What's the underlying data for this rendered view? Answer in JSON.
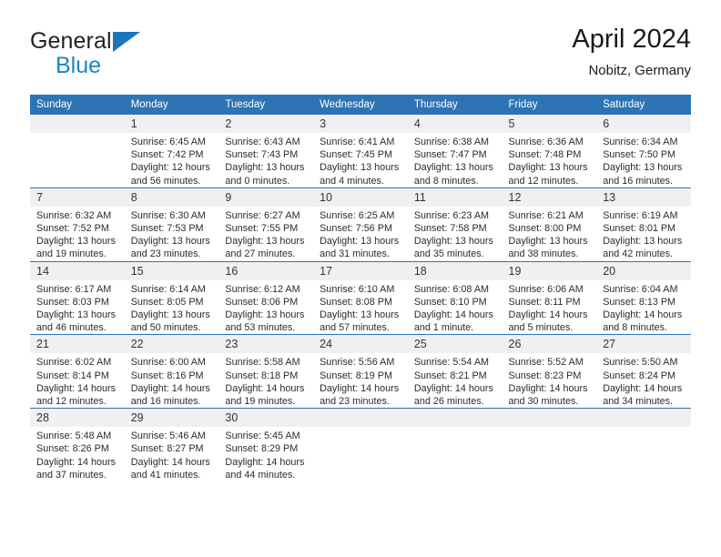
{
  "brand": {
    "name_top": "General",
    "name_bottom": "Blue",
    "triangle_color": "#1b75bb",
    "text_color_top": "#231f20",
    "text_color_bottom": "#1b84c9"
  },
  "header": {
    "title": "April 2024",
    "subtitle": "Nobitz, Germany",
    "accent_color": "#2e74b5",
    "daynum_band_color": "#f0f0f0"
  },
  "weekday_headers": [
    "Sunday",
    "Monday",
    "Tuesday",
    "Wednesday",
    "Thursday",
    "Friday",
    "Saturday"
  ],
  "weeks": [
    [
      {
        "day": "",
        "sunrise": "",
        "sunset": "",
        "daylight_1": "",
        "daylight_2": ""
      },
      {
        "day": "1",
        "sunrise": "Sunrise: 6:45 AM",
        "sunset": "Sunset: 7:42 PM",
        "daylight_1": "Daylight: 12 hours",
        "daylight_2": "and 56 minutes."
      },
      {
        "day": "2",
        "sunrise": "Sunrise: 6:43 AM",
        "sunset": "Sunset: 7:43 PM",
        "daylight_1": "Daylight: 13 hours",
        "daylight_2": "and 0 minutes."
      },
      {
        "day": "3",
        "sunrise": "Sunrise: 6:41 AM",
        "sunset": "Sunset: 7:45 PM",
        "daylight_1": "Daylight: 13 hours",
        "daylight_2": "and 4 minutes."
      },
      {
        "day": "4",
        "sunrise": "Sunrise: 6:38 AM",
        "sunset": "Sunset: 7:47 PM",
        "daylight_1": "Daylight: 13 hours",
        "daylight_2": "and 8 minutes."
      },
      {
        "day": "5",
        "sunrise": "Sunrise: 6:36 AM",
        "sunset": "Sunset: 7:48 PM",
        "daylight_1": "Daylight: 13 hours",
        "daylight_2": "and 12 minutes."
      },
      {
        "day": "6",
        "sunrise": "Sunrise: 6:34 AM",
        "sunset": "Sunset: 7:50 PM",
        "daylight_1": "Daylight: 13 hours",
        "daylight_2": "and 16 minutes."
      }
    ],
    [
      {
        "day": "7",
        "sunrise": "Sunrise: 6:32 AM",
        "sunset": "Sunset: 7:52 PM",
        "daylight_1": "Daylight: 13 hours",
        "daylight_2": "and 19 minutes."
      },
      {
        "day": "8",
        "sunrise": "Sunrise: 6:30 AM",
        "sunset": "Sunset: 7:53 PM",
        "daylight_1": "Daylight: 13 hours",
        "daylight_2": "and 23 minutes."
      },
      {
        "day": "9",
        "sunrise": "Sunrise: 6:27 AM",
        "sunset": "Sunset: 7:55 PM",
        "daylight_1": "Daylight: 13 hours",
        "daylight_2": "and 27 minutes."
      },
      {
        "day": "10",
        "sunrise": "Sunrise: 6:25 AM",
        "sunset": "Sunset: 7:56 PM",
        "daylight_1": "Daylight: 13 hours",
        "daylight_2": "and 31 minutes."
      },
      {
        "day": "11",
        "sunrise": "Sunrise: 6:23 AM",
        "sunset": "Sunset: 7:58 PM",
        "daylight_1": "Daylight: 13 hours",
        "daylight_2": "and 35 minutes."
      },
      {
        "day": "12",
        "sunrise": "Sunrise: 6:21 AM",
        "sunset": "Sunset: 8:00 PM",
        "daylight_1": "Daylight: 13 hours",
        "daylight_2": "and 38 minutes."
      },
      {
        "day": "13",
        "sunrise": "Sunrise: 6:19 AM",
        "sunset": "Sunset: 8:01 PM",
        "daylight_1": "Daylight: 13 hours",
        "daylight_2": "and 42 minutes."
      }
    ],
    [
      {
        "day": "14",
        "sunrise": "Sunrise: 6:17 AM",
        "sunset": "Sunset: 8:03 PM",
        "daylight_1": "Daylight: 13 hours",
        "daylight_2": "and 46 minutes."
      },
      {
        "day": "15",
        "sunrise": "Sunrise: 6:14 AM",
        "sunset": "Sunset: 8:05 PM",
        "daylight_1": "Daylight: 13 hours",
        "daylight_2": "and 50 minutes."
      },
      {
        "day": "16",
        "sunrise": "Sunrise: 6:12 AM",
        "sunset": "Sunset: 8:06 PM",
        "daylight_1": "Daylight: 13 hours",
        "daylight_2": "and 53 minutes."
      },
      {
        "day": "17",
        "sunrise": "Sunrise: 6:10 AM",
        "sunset": "Sunset: 8:08 PM",
        "daylight_1": "Daylight: 13 hours",
        "daylight_2": "and 57 minutes."
      },
      {
        "day": "18",
        "sunrise": "Sunrise: 6:08 AM",
        "sunset": "Sunset: 8:10 PM",
        "daylight_1": "Daylight: 14 hours",
        "daylight_2": "and 1 minute."
      },
      {
        "day": "19",
        "sunrise": "Sunrise: 6:06 AM",
        "sunset": "Sunset: 8:11 PM",
        "daylight_1": "Daylight: 14 hours",
        "daylight_2": "and 5 minutes."
      },
      {
        "day": "20",
        "sunrise": "Sunrise: 6:04 AM",
        "sunset": "Sunset: 8:13 PM",
        "daylight_1": "Daylight: 14 hours",
        "daylight_2": "and 8 minutes."
      }
    ],
    [
      {
        "day": "21",
        "sunrise": "Sunrise: 6:02 AM",
        "sunset": "Sunset: 8:14 PM",
        "daylight_1": "Daylight: 14 hours",
        "daylight_2": "and 12 minutes."
      },
      {
        "day": "22",
        "sunrise": "Sunrise: 6:00 AM",
        "sunset": "Sunset: 8:16 PM",
        "daylight_1": "Daylight: 14 hours",
        "daylight_2": "and 16 minutes."
      },
      {
        "day": "23",
        "sunrise": "Sunrise: 5:58 AM",
        "sunset": "Sunset: 8:18 PM",
        "daylight_1": "Daylight: 14 hours",
        "daylight_2": "and 19 minutes."
      },
      {
        "day": "24",
        "sunrise": "Sunrise: 5:56 AM",
        "sunset": "Sunset: 8:19 PM",
        "daylight_1": "Daylight: 14 hours",
        "daylight_2": "and 23 minutes."
      },
      {
        "day": "25",
        "sunrise": "Sunrise: 5:54 AM",
        "sunset": "Sunset: 8:21 PM",
        "daylight_1": "Daylight: 14 hours",
        "daylight_2": "and 26 minutes."
      },
      {
        "day": "26",
        "sunrise": "Sunrise: 5:52 AM",
        "sunset": "Sunset: 8:23 PM",
        "daylight_1": "Daylight: 14 hours",
        "daylight_2": "and 30 minutes."
      },
      {
        "day": "27",
        "sunrise": "Sunrise: 5:50 AM",
        "sunset": "Sunset: 8:24 PM",
        "daylight_1": "Daylight: 14 hours",
        "daylight_2": "and 34 minutes."
      }
    ],
    [
      {
        "day": "28",
        "sunrise": "Sunrise: 5:48 AM",
        "sunset": "Sunset: 8:26 PM",
        "daylight_1": "Daylight: 14 hours",
        "daylight_2": "and 37 minutes."
      },
      {
        "day": "29",
        "sunrise": "Sunrise: 5:46 AM",
        "sunset": "Sunset: 8:27 PM",
        "daylight_1": "Daylight: 14 hours",
        "daylight_2": "and 41 minutes."
      },
      {
        "day": "30",
        "sunrise": "Sunrise: 5:45 AM",
        "sunset": "Sunset: 8:29 PM",
        "daylight_1": "Daylight: 14 hours",
        "daylight_2": "and 44 minutes."
      },
      {
        "day": "",
        "sunrise": "",
        "sunset": "",
        "daylight_1": "",
        "daylight_2": ""
      },
      {
        "day": "",
        "sunrise": "",
        "sunset": "",
        "daylight_1": "",
        "daylight_2": ""
      },
      {
        "day": "",
        "sunrise": "",
        "sunset": "",
        "daylight_1": "",
        "daylight_2": ""
      },
      {
        "day": "",
        "sunrise": "",
        "sunset": "",
        "daylight_1": "",
        "daylight_2": ""
      }
    ]
  ]
}
